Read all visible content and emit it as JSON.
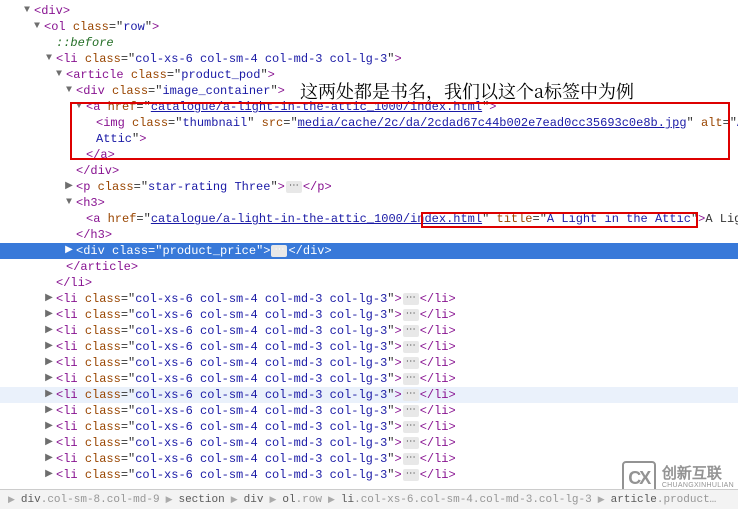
{
  "annotation": "这两处都是书名，我们以这个a标签中为例",
  "pseudo": "::before",
  "root": {
    "tag": "div"
  },
  "ol": {
    "tag": "ol",
    "class": "row"
  },
  "li_class": "col-xs-6 col-sm-4 col-md-3 col-lg-3",
  "article": {
    "tag": "article",
    "class": "product_pod"
  },
  "img_div": {
    "tag": "div",
    "class": "image_container"
  },
  "a1": {
    "href": "catalogue/a-light-in-the-attic_1000/index.html"
  },
  "img": {
    "class": "thumbnail",
    "src": "media/cache/2c/da/2cdad67c44b002e7ead0cc35693c0e8b.jpg",
    "alt": "A Light in the Attic"
  },
  "p": {
    "tag": "p",
    "class": "star-rating Three"
  },
  "h3": {
    "tag": "h3"
  },
  "a2": {
    "href": "catalogue/a-light-in-the-attic_1000/index.html",
    "title": "A Light in the Attic",
    "text": "A Light in the ."
  },
  "price_div": {
    "tag": "div",
    "class": "product_price"
  },
  "ellipsis": "⋯",
  "breadcrumb": [
    {
      "t": "div",
      "c": "col-sm-8 col-md-9"
    },
    {
      "t": "section",
      "c": ""
    },
    {
      "t": "div",
      "c": ""
    },
    {
      "t": "ol",
      "c": "row"
    },
    {
      "t": "li",
      "c": "col-xs-6 col-sm-4 col-md-3 col-lg-3"
    },
    {
      "t": "article",
      "c": "product…"
    }
  ],
  "logo": {
    "cn": "创新互联",
    "en": "CHUANGXINHULIAN"
  }
}
